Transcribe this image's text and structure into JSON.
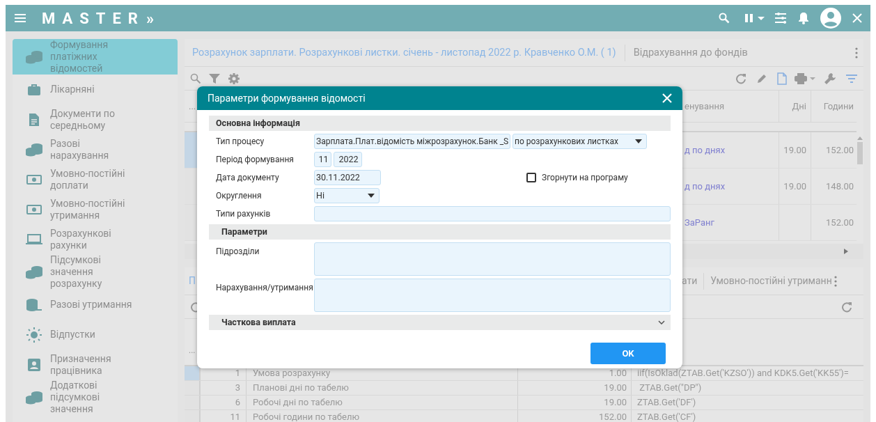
{
  "top_bar": {
    "app_name": "MASTER",
    "expand_glyph": "»"
  },
  "sidebar": {
    "items": [
      {
        "label": "Формування платіжних відомостей",
        "selected": true
      },
      {
        "label": "Лікарняні",
        "selected": false
      },
      {
        "label": "Документи по середньому",
        "selected": false
      },
      {
        "label": "Разові нарахування",
        "selected": false
      },
      {
        "label": "Умовно-постійні доплати",
        "selected": false
      },
      {
        "label": "Умовно-постійні утримання",
        "selected": false
      },
      {
        "label": "Розрахункові рахунки",
        "selected": false
      },
      {
        "label": "Підсумкові значення розрахунку",
        "selected": false
      },
      {
        "label": "Разові утримання",
        "selected": false
      },
      {
        "label": "Відпустки",
        "selected": false
      },
      {
        "label": "Призначення працівника",
        "selected": false
      },
      {
        "label": "Додаткові підсумкові значення",
        "selected": false
      }
    ]
  },
  "main": {
    "tabs": [
      {
        "label": "Розрахунок зарплати. Розрахункові листки. січень - листопад 2022 р. Кравченко О.М. ( 1)",
        "selected": true
      },
      {
        "label": "Відрахування до фондів",
        "selected": false
      }
    ],
    "table": {
      "selector_header": "...",
      "columns": [
        "енування",
        "Дні",
        "Години"
      ],
      "rows": [
        {
          "cells": [
            "д по днях",
            "19.00",
            "152.00"
          ],
          "selected": true
        },
        {
          "cells": [
            "д по днях",
            "19.00",
            "148.00"
          ],
          "selected": false
        },
        {
          "cells": [
            "ЗаРанг",
            "",
            "152.00"
          ],
          "selected": false
        }
      ]
    }
  },
  "lower": {
    "tabs": [
      {
        "label": "П",
        "selected": true
      },
      {
        "label": "ати",
        "selected": false
      },
      {
        "label": "Умовно-постійні утриманн",
        "selected": false
      }
    ],
    "header": "...",
    "rows": [
      {
        "number": "1",
        "name": "Умова розрахунку",
        "value": "1.00",
        "formula": "iif(IsOklad(ZTAB.Get('KZSO')) and KDK5.Get('KK55')=",
        "selected": true
      },
      {
        "number": "3",
        "name": "Планові дні по табелю",
        "value": "19.00",
        "formula": " ZTAB.Get(\"DP\")",
        "selected": false
      },
      {
        "number": "6",
        "name": "Робочі дні по табелю",
        "value": "19.00",
        "formula": "ZTAB.Get('DF')",
        "selected": false
      },
      {
        "number": "11",
        "name": "Робочі години по табелю",
        "value": "152.00",
        "formula": "ZTAB.Get('CF')",
        "selected": false
      }
    ]
  },
  "dialog": {
    "title": "Параметри формування відомості",
    "section_main": "Основна інформація",
    "process_type": {
      "label": "Тип процесу",
      "value": "Зарплата.Плат.відомість міжрозрахунок.Банк _S",
      "mode": "по розрахункових листках"
    },
    "period": {
      "label": "Період формування",
      "month": "11",
      "year": "2022"
    },
    "document_date": {
      "label": "Дата документу",
      "value": "30.11.2022"
    },
    "collapse_checkbox": {
      "label": "Згорнути на програму",
      "checked": false
    },
    "rounding": {
      "label": "Округлення",
      "value": "Ні"
    },
    "account_types": {
      "label": "Типи рахунків"
    },
    "section_params": "Параметри",
    "departments": {
      "label": "Підрозділи"
    },
    "accruals": {
      "label": "Нарахування/утримання"
    },
    "partial_payment": {
      "label": "Часткова виплата",
      "expanded": false
    },
    "ok_button": "OK"
  }
}
